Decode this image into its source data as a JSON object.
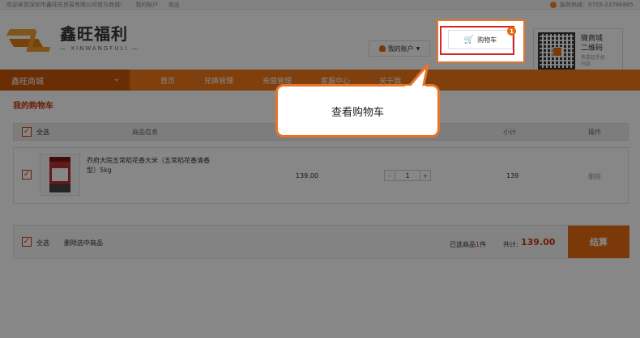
{
  "topbar": {
    "welcome": "欢迎来到深圳市鑫旺旺贸易有限公司官方商城！",
    "account_link": "我的账户",
    "logout_link": "退出",
    "hotline": "服务热线：0755-23766865"
  },
  "logo": {
    "cn": "鑫旺福利",
    "en": "— XINWANGFULI —",
    "mark": "XW"
  },
  "header": {
    "account_label": "我的账户",
    "cart_label": "购物车",
    "cart_badge": "1",
    "qr_title_line1": "微商城",
    "qr_title_line2": "二维码",
    "qr_sub_line1": "快拿起手机",
    "qr_sub_line2": "扫我"
  },
  "nav": {
    "brand": "鑫旺商城",
    "items": [
      "首页",
      "兑换管理",
      "充值管理",
      "客服中心",
      "关于我"
    ]
  },
  "cart": {
    "title": "我的购物车",
    "header": {
      "select_all": "全选",
      "info": "商品信息",
      "subtotal": "小计",
      "operation": "操作"
    },
    "items": [
      {
        "name": "乔府大院五常稻花香大米（五常稻花香清香型）5kg",
        "price": "139.00",
        "quantity": "1",
        "subtotal": "139",
        "delete": "删除"
      }
    ],
    "footer": {
      "select_all": "全选",
      "delete_selected": "删除选中商品",
      "selected_prefix": "已选商品",
      "selected_count": "1",
      "selected_suffix": "件",
      "total_label": "共计:",
      "total": "139.00",
      "checkout": "结算"
    }
  },
  "tooltip": {
    "text": "查看购物车"
  },
  "colors": {
    "accent": "#f07a1c",
    "dark_accent": "#c9580a",
    "price": "#c9380a",
    "highlight": "#d9232a"
  },
  "icons": {
    "check": "✓",
    "minus": "-",
    "plus": "+",
    "caret": "▼",
    "chevron": "⌄",
    "cart": "🛒"
  }
}
